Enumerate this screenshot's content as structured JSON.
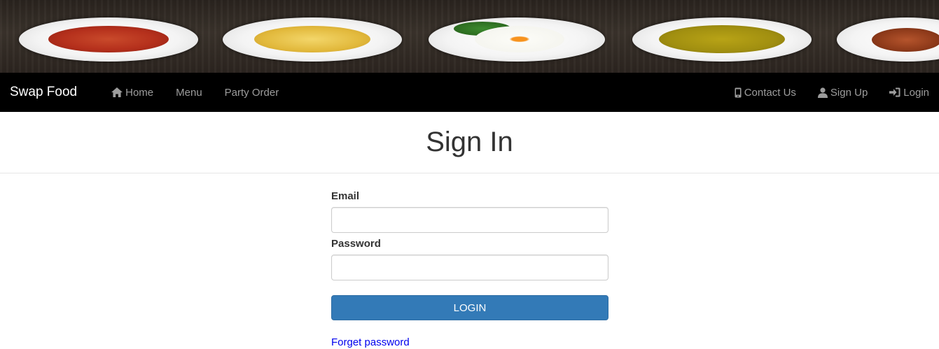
{
  "navbar": {
    "brand": "Swap Food",
    "left_links": [
      {
        "label": "Home",
        "icon": "home-icon"
      },
      {
        "label": "Menu"
      },
      {
        "label": "Party Order"
      }
    ],
    "right_links": [
      {
        "label": "Contact Us",
        "icon": "phone-icon"
      },
      {
        "label": "Sign Up",
        "icon": "user-icon"
      },
      {
        "label": "Login",
        "icon": "login-icon"
      }
    ]
  },
  "page": {
    "title": "Sign In"
  },
  "form": {
    "email_label": "Email",
    "email_value": "",
    "password_label": "Password",
    "password_value": "",
    "submit_label": "LOGIN",
    "forget_link": "Forget password"
  },
  "colors": {
    "navbar_bg": "#000000",
    "button_primary": "#337ab7",
    "link": "#0000ee"
  }
}
